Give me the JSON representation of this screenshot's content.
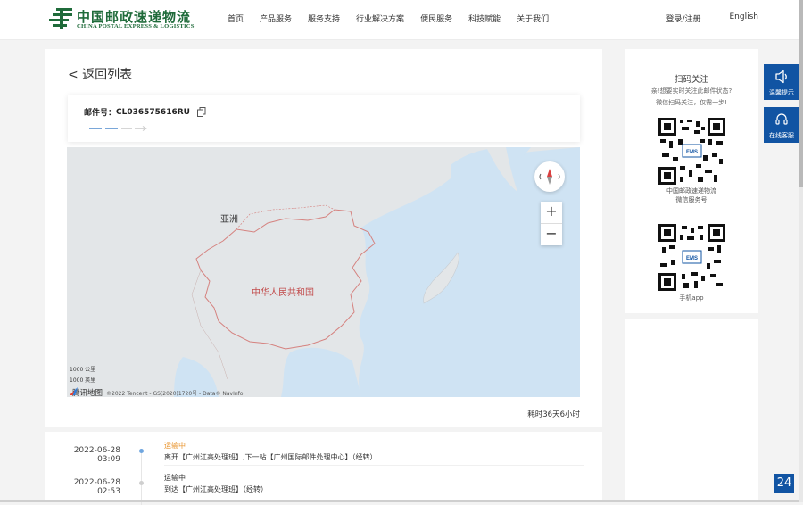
{
  "header": {
    "logo_cn": "中国邮政速递物流",
    "logo_en": "CHINA POSTAL EXPRESS & LOGISTICS",
    "nav": [
      "首页",
      "产品服务",
      "服务支持",
      "行业解决方案",
      "便民服务",
      "科技赋能",
      "关于我们"
    ],
    "login": "登录/注册",
    "language": "English"
  },
  "main": {
    "back_label": "< 返回列表",
    "mail_label": "邮件号：",
    "mail_number": "CL036575616RU",
    "elapsed": "耗时36天6小时"
  },
  "map": {
    "label_asia": "亚洲",
    "label_china": "中华人民共和国",
    "scale_km": "1000 公里",
    "scale_mi": "1000 英里",
    "provider": "腾讯地图",
    "copyright": "©2022 Tencent - GS(2020)1720号 - Data© NavInfo",
    "zoom_in": "+",
    "zoom_out": "−",
    "colors": {
      "land": "#e3e6e8",
      "sea": "#cfe3f3",
      "border": "#d5827f"
    }
  },
  "timeline": [
    {
      "date": "2022-06-28",
      "time": "03:09",
      "status": "运输中",
      "desc": "离开【广州江高处理班】,下一站【广州国际邮件处理中心】（经转）",
      "active": true
    },
    {
      "date": "2022-06-28",
      "time": "02:53",
      "status": "运输中",
      "desc": "到达【广州江高处理班】（经转）",
      "active": false
    }
  ],
  "sidebar": {
    "title": "扫码关注",
    "line1": "亲!想要实时关注此邮件状态?",
    "line2": "微信扫码关注，仅需一步!",
    "qr1_caption1": "中国邮政速递物流",
    "qr1_caption2": "微信服务号",
    "qr2_caption": "手机app",
    "qr_center": "EMS"
  },
  "float": {
    "tips": "温馨提示",
    "service": "在线客服",
    "badge": "24"
  },
  "colors": {
    "accent": "#1154a3",
    "status_active": "#e8932b",
    "brand_green": "#1f6b3a"
  }
}
